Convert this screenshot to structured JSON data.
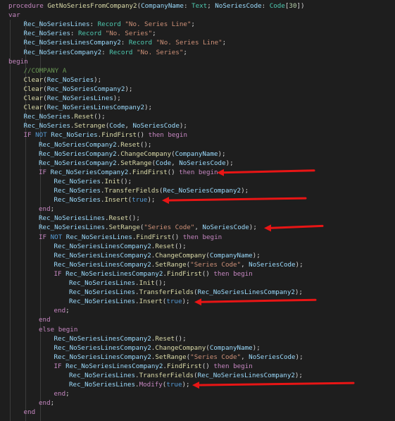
{
  "colors": {
    "bg": "#1e1e1e",
    "keyword": "#c586c0",
    "blue": "#569cd6",
    "function": "#dcdcaa",
    "variable": "#9cdcfe",
    "type": "#4ec9b0",
    "string": "#ce9178",
    "number": "#b5cea8",
    "comment": "#6a9955",
    "punct": "#d4d4d4",
    "arrow": "#e81515"
  },
  "code_lines": [
    {
      "indent": 0,
      "tokens": [
        {
          "t": "procedure ",
          "c": "kw"
        },
        {
          "t": "GetNoSeriesFromCompany2",
          "c": "fn"
        },
        {
          "t": "(",
          "c": "p"
        },
        {
          "t": "CompanyName",
          "c": "var"
        },
        {
          "t": ": ",
          "c": "p"
        },
        {
          "t": "Text",
          "c": "type"
        },
        {
          "t": "; ",
          "c": "p"
        },
        {
          "t": "NoSeriesCode",
          "c": "var"
        },
        {
          "t": ": ",
          "c": "p"
        },
        {
          "t": "Code",
          "c": "type"
        },
        {
          "t": "[",
          "c": "p"
        },
        {
          "t": "30",
          "c": "num"
        },
        {
          "t": "])",
          "c": "p"
        }
      ]
    },
    {
      "indent": 0,
      "tokens": [
        {
          "t": "var",
          "c": "kw"
        }
      ]
    },
    {
      "indent": 1,
      "tokens": [
        {
          "t": "Rec_NoSeriesLines",
          "c": "var"
        },
        {
          "t": ": ",
          "c": "p"
        },
        {
          "t": "Record",
          "c": "type"
        },
        {
          "t": " ",
          "c": "p"
        },
        {
          "t": "\"No. Series Line\"",
          "c": "str"
        },
        {
          "t": ";",
          "c": "p"
        }
      ]
    },
    {
      "indent": 1,
      "tokens": [
        {
          "t": "Rec_NoSeries",
          "c": "var"
        },
        {
          "t": ": ",
          "c": "p"
        },
        {
          "t": "Record",
          "c": "type"
        },
        {
          "t": " ",
          "c": "p"
        },
        {
          "t": "\"No. Series\"",
          "c": "str"
        },
        {
          "t": ";",
          "c": "p"
        }
      ]
    },
    {
      "indent": 1,
      "tokens": [
        {
          "t": "Rec_NoSeriesLinesCompany2",
          "c": "var"
        },
        {
          "t": ": ",
          "c": "p"
        },
        {
          "t": "Record",
          "c": "type"
        },
        {
          "t": " ",
          "c": "p"
        },
        {
          "t": "\"No. Series Line\"",
          "c": "str"
        },
        {
          "t": ";",
          "c": "p"
        }
      ]
    },
    {
      "indent": 1,
      "tokens": [
        {
          "t": "Rec_NoSeriesCompany2",
          "c": "var"
        },
        {
          "t": ": ",
          "c": "p"
        },
        {
          "t": "Record",
          "c": "type"
        },
        {
          "t": " ",
          "c": "p"
        },
        {
          "t": "\"No. Series\"",
          "c": "str"
        },
        {
          "t": ";",
          "c": "p"
        }
      ]
    },
    {
      "indent": 0,
      "tokens": [
        {
          "t": "begin",
          "c": "kw"
        }
      ]
    },
    {
      "indent": 1,
      "tokens": [
        {
          "t": "//COMPANY A",
          "c": "cmt"
        }
      ]
    },
    {
      "indent": 1,
      "tokens": [
        {
          "t": "Clear",
          "c": "fn"
        },
        {
          "t": "(",
          "c": "p"
        },
        {
          "t": "Rec_NoSeries",
          "c": "var"
        },
        {
          "t": ");",
          "c": "p"
        }
      ]
    },
    {
      "indent": 1,
      "tokens": [
        {
          "t": "Clear",
          "c": "fn"
        },
        {
          "t": "(",
          "c": "p"
        },
        {
          "t": "Rec_NoSeriesCompany2",
          "c": "var"
        },
        {
          "t": ");",
          "c": "p"
        }
      ]
    },
    {
      "indent": 1,
      "tokens": [
        {
          "t": "Clear",
          "c": "fn"
        },
        {
          "t": "(",
          "c": "p"
        },
        {
          "t": "Rec_NoSeriesLines",
          "c": "var"
        },
        {
          "t": ");",
          "c": "p"
        }
      ]
    },
    {
      "indent": 1,
      "tokens": [
        {
          "t": "Clear",
          "c": "fn"
        },
        {
          "t": "(",
          "c": "p"
        },
        {
          "t": "Rec_NoSeriesLinesCompany2",
          "c": "var"
        },
        {
          "t": ");",
          "c": "p"
        }
      ]
    },
    {
      "indent": 1,
      "tokens": [
        {
          "t": "Rec_NoSeries",
          "c": "var"
        },
        {
          "t": ".",
          "c": "p"
        },
        {
          "t": "Reset",
          "c": "fn"
        },
        {
          "t": "();",
          "c": "p"
        }
      ]
    },
    {
      "indent": 1,
      "tokens": [
        {
          "t": "Rec_NoSeries",
          "c": "var"
        },
        {
          "t": ".",
          "c": "p"
        },
        {
          "t": "Setrange",
          "c": "fn"
        },
        {
          "t": "(",
          "c": "p"
        },
        {
          "t": "Code",
          "c": "var"
        },
        {
          "t": ", ",
          "c": "p"
        },
        {
          "t": "NoSeriesCode",
          "c": "var"
        },
        {
          "t": ");",
          "c": "p"
        }
      ]
    },
    {
      "indent": 1,
      "tokens": [
        {
          "t": "IF",
          "c": "kw"
        },
        {
          "t": " ",
          "c": "p"
        },
        {
          "t": "NOT",
          "c": "blue"
        },
        {
          "t": " ",
          "c": "p"
        },
        {
          "t": "Rec_NoSeries",
          "c": "var"
        },
        {
          "t": ".",
          "c": "p"
        },
        {
          "t": "FindFirst",
          "c": "fn"
        },
        {
          "t": "() ",
          "c": "p"
        },
        {
          "t": "then",
          "c": "kw"
        },
        {
          "t": " ",
          "c": "p"
        },
        {
          "t": "begin",
          "c": "kw"
        }
      ]
    },
    {
      "indent": 2,
      "tokens": [
        {
          "t": "Rec_NoSeriesCompany2",
          "c": "var"
        },
        {
          "t": ".",
          "c": "p"
        },
        {
          "t": "Reset",
          "c": "fn"
        },
        {
          "t": "();",
          "c": "p"
        }
      ]
    },
    {
      "indent": 2,
      "tokens": [
        {
          "t": "Rec_NoSeriesCompany2",
          "c": "var"
        },
        {
          "t": ".",
          "c": "p"
        },
        {
          "t": "ChangeCompany",
          "c": "fn"
        },
        {
          "t": "(",
          "c": "p"
        },
        {
          "t": "CompanyName",
          "c": "var"
        },
        {
          "t": ");",
          "c": "p"
        }
      ]
    },
    {
      "indent": 2,
      "tokens": [
        {
          "t": "Rec_NoSeriesCompany2",
          "c": "var"
        },
        {
          "t": ".",
          "c": "p"
        },
        {
          "t": "SetRange",
          "c": "fn"
        },
        {
          "t": "(",
          "c": "p"
        },
        {
          "t": "Code",
          "c": "var"
        },
        {
          "t": ", ",
          "c": "p"
        },
        {
          "t": "NoSeriesCode",
          "c": "var"
        },
        {
          "t": ");",
          "c": "p"
        }
      ]
    },
    {
      "indent": 2,
      "tokens": [
        {
          "t": "IF",
          "c": "kw"
        },
        {
          "t": " ",
          "c": "p"
        },
        {
          "t": "Rec_NoSeriesCompany2",
          "c": "var"
        },
        {
          "t": ".",
          "c": "p"
        },
        {
          "t": "FindFirst",
          "c": "fn"
        },
        {
          "t": "() ",
          "c": "p"
        },
        {
          "t": "then",
          "c": "kw"
        },
        {
          "t": " ",
          "c": "p"
        },
        {
          "t": "begin",
          "c": "kw"
        }
      ]
    },
    {
      "indent": 3,
      "tokens": [
        {
          "t": "Rec_NoSeries",
          "c": "var"
        },
        {
          "t": ".",
          "c": "p"
        },
        {
          "t": "Init",
          "c": "fn"
        },
        {
          "t": "();",
          "c": "p"
        }
      ]
    },
    {
      "indent": 3,
      "tokens": [
        {
          "t": "Rec_NoSeries",
          "c": "var"
        },
        {
          "t": ".",
          "c": "p"
        },
        {
          "t": "TransferFields",
          "c": "fn"
        },
        {
          "t": "(",
          "c": "p"
        },
        {
          "t": "Rec_NoSeriesCompany2",
          "c": "var"
        },
        {
          "t": ");",
          "c": "p"
        }
      ]
    },
    {
      "indent": 3,
      "tokens": [
        {
          "t": "Rec_NoSeries",
          "c": "var"
        },
        {
          "t": ".",
          "c": "p"
        },
        {
          "t": "Insert",
          "c": "fn"
        },
        {
          "t": "(",
          "c": "p"
        },
        {
          "t": "true",
          "c": "blue"
        },
        {
          "t": ");",
          "c": "p"
        }
      ]
    },
    {
      "indent": 2,
      "tokens": [
        {
          "t": "end",
          "c": "kw"
        },
        {
          "t": ";",
          "c": "p"
        }
      ]
    },
    {
      "indent": 2,
      "tokens": [
        {
          "t": "Rec_NoSeriesLines",
          "c": "var"
        },
        {
          "t": ".",
          "c": "p"
        },
        {
          "t": "Reset",
          "c": "fn"
        },
        {
          "t": "();",
          "c": "p"
        }
      ]
    },
    {
      "indent": 2,
      "tokens": [
        {
          "t": "Rec_NoSeriesLines",
          "c": "var"
        },
        {
          "t": ".",
          "c": "p"
        },
        {
          "t": "SetRange",
          "c": "fn"
        },
        {
          "t": "(",
          "c": "p"
        },
        {
          "t": "\"Series Code\"",
          "c": "str"
        },
        {
          "t": ", ",
          "c": "p"
        },
        {
          "t": "NoSeriesCode",
          "c": "var"
        },
        {
          "t": ");",
          "c": "p"
        }
      ]
    },
    {
      "indent": 2,
      "tokens": [
        {
          "t": "IF",
          "c": "kw"
        },
        {
          "t": " ",
          "c": "p"
        },
        {
          "t": "NOT",
          "c": "blue"
        },
        {
          "t": " ",
          "c": "p"
        },
        {
          "t": "Rec_NoSeriesLines",
          "c": "var"
        },
        {
          "t": ".",
          "c": "p"
        },
        {
          "t": "FindFirst",
          "c": "fn"
        },
        {
          "t": "() ",
          "c": "p"
        },
        {
          "t": "then",
          "c": "kw"
        },
        {
          "t": " ",
          "c": "p"
        },
        {
          "t": "begin",
          "c": "kw"
        }
      ]
    },
    {
      "indent": 3,
      "tokens": [
        {
          "t": "Rec_NoSeriesLinesCompany2",
          "c": "var"
        },
        {
          "t": ".",
          "c": "p"
        },
        {
          "t": "Reset",
          "c": "fn"
        },
        {
          "t": "();",
          "c": "p"
        }
      ]
    },
    {
      "indent": 3,
      "tokens": [
        {
          "t": "Rec_NoSeriesLinesCompany2",
          "c": "var"
        },
        {
          "t": ".",
          "c": "p"
        },
        {
          "t": "ChangeCompany",
          "c": "fn"
        },
        {
          "t": "(",
          "c": "p"
        },
        {
          "t": "CompanyName",
          "c": "var"
        },
        {
          "t": ");",
          "c": "p"
        }
      ]
    },
    {
      "indent": 3,
      "tokens": [
        {
          "t": "Rec_NoSeriesLinesCompany2",
          "c": "var"
        },
        {
          "t": ".",
          "c": "p"
        },
        {
          "t": "SetRange",
          "c": "fn"
        },
        {
          "t": "(",
          "c": "p"
        },
        {
          "t": "\"Series Code\"",
          "c": "str"
        },
        {
          "t": ", ",
          "c": "p"
        },
        {
          "t": "NoSeriesCode",
          "c": "var"
        },
        {
          "t": ");",
          "c": "p"
        }
      ]
    },
    {
      "indent": 3,
      "tokens": [
        {
          "t": "IF",
          "c": "kw"
        },
        {
          "t": " ",
          "c": "p"
        },
        {
          "t": "Rec_NoSeriesLinesCompany2",
          "c": "var"
        },
        {
          "t": ".",
          "c": "p"
        },
        {
          "t": "FindFirst",
          "c": "fn"
        },
        {
          "t": "() ",
          "c": "p"
        },
        {
          "t": "then",
          "c": "kw"
        },
        {
          "t": " ",
          "c": "p"
        },
        {
          "t": "begin",
          "c": "kw"
        }
      ]
    },
    {
      "indent": 4,
      "tokens": [
        {
          "t": "Rec_NoSeriesLines",
          "c": "var"
        },
        {
          "t": ".",
          "c": "p"
        },
        {
          "t": "Init",
          "c": "fn"
        },
        {
          "t": "();",
          "c": "p"
        }
      ]
    },
    {
      "indent": 4,
      "tokens": [
        {
          "t": "Rec_NoSeriesLines",
          "c": "var"
        },
        {
          "t": ".",
          "c": "p"
        },
        {
          "t": "TransferFields",
          "c": "fn"
        },
        {
          "t": "(",
          "c": "p"
        },
        {
          "t": "Rec_NoSeriesLinesCompany2",
          "c": "var"
        },
        {
          "t": ");",
          "c": "p"
        }
      ]
    },
    {
      "indent": 4,
      "tokens": [
        {
          "t": "Rec_NoSeriesLines",
          "c": "var"
        },
        {
          "t": ".",
          "c": "p"
        },
        {
          "t": "Insert",
          "c": "fn"
        },
        {
          "t": "(",
          "c": "p"
        },
        {
          "t": "true",
          "c": "blue"
        },
        {
          "t": ");",
          "c": "p"
        }
      ]
    },
    {
      "indent": 3,
      "tokens": [
        {
          "t": "end",
          "c": "kw"
        },
        {
          "t": ";",
          "c": "p"
        }
      ]
    },
    {
      "indent": 2,
      "tokens": [
        {
          "t": "end",
          "c": "kw"
        }
      ]
    },
    {
      "indent": 2,
      "tokens": [
        {
          "t": "else",
          "c": "kw"
        },
        {
          "t": " ",
          "c": "p"
        },
        {
          "t": "begin",
          "c": "kw"
        }
      ]
    },
    {
      "indent": 3,
      "tokens": [
        {
          "t": "Rec_NoSeriesLinesCompany2",
          "c": "var"
        },
        {
          "t": ".",
          "c": "p"
        },
        {
          "t": "Reset",
          "c": "fn"
        },
        {
          "t": "();",
          "c": "p"
        }
      ]
    },
    {
      "indent": 3,
      "tokens": [
        {
          "t": "Rec_NoSeriesLinesCompany2",
          "c": "var"
        },
        {
          "t": ".",
          "c": "p"
        },
        {
          "t": "ChangeCompany",
          "c": "fn"
        },
        {
          "t": "(",
          "c": "p"
        },
        {
          "t": "CompanyName",
          "c": "var"
        },
        {
          "t": ");",
          "c": "p"
        }
      ]
    },
    {
      "indent": 3,
      "tokens": [
        {
          "t": "Rec_NoSeriesLinesCompany2",
          "c": "var"
        },
        {
          "t": ".",
          "c": "p"
        },
        {
          "t": "SetRange",
          "c": "fn"
        },
        {
          "t": "(",
          "c": "p"
        },
        {
          "t": "\"Series Code\"",
          "c": "str"
        },
        {
          "t": ", ",
          "c": "p"
        },
        {
          "t": "NoSeriesCode",
          "c": "var"
        },
        {
          "t": ");",
          "c": "p"
        }
      ]
    },
    {
      "indent": 3,
      "tokens": [
        {
          "t": "IF",
          "c": "kw"
        },
        {
          "t": " ",
          "c": "p"
        },
        {
          "t": "Rec_NoSeriesLinesCompany2",
          "c": "var"
        },
        {
          "t": ".",
          "c": "p"
        },
        {
          "t": "FindFirst",
          "c": "fn"
        },
        {
          "t": "() ",
          "c": "p"
        },
        {
          "t": "then",
          "c": "kw"
        },
        {
          "t": " ",
          "c": "p"
        },
        {
          "t": "begin",
          "c": "kw"
        }
      ]
    },
    {
      "indent": 4,
      "tokens": [
        {
          "t": "Rec_NoSeriesLines",
          "c": "var"
        },
        {
          "t": ".",
          "c": "p"
        },
        {
          "t": "TransferFields",
          "c": "fn"
        },
        {
          "t": "(",
          "c": "p"
        },
        {
          "t": "Rec_NoSeriesLinesCompany2",
          "c": "var"
        },
        {
          "t": ");",
          "c": "p"
        }
      ]
    },
    {
      "indent": 4,
      "tokens": [
        {
          "t": "Rec_NoSeriesLines",
          "c": "var"
        },
        {
          "t": ".",
          "c": "p"
        },
        {
          "t": "Modify",
          "c": "kw"
        },
        {
          "t": "(",
          "c": "p"
        },
        {
          "t": "true",
          "c": "blue"
        },
        {
          "t": ");",
          "c": "p"
        }
      ]
    },
    {
      "indent": 3,
      "tokens": [
        {
          "t": "end",
          "c": "kw"
        },
        {
          "t": ";",
          "c": "p"
        }
      ]
    },
    {
      "indent": 2,
      "tokens": [
        {
          "t": "end",
          "c": "kw"
        },
        {
          "t": ";",
          "c": "p"
        }
      ]
    },
    {
      "indent": 1,
      "tokens": [
        {
          "t": "end",
          "c": "kw"
        }
      ]
    }
  ],
  "annotations": {
    "arrow_target_lines": [
      18,
      21,
      24,
      32,
      41
    ]
  }
}
